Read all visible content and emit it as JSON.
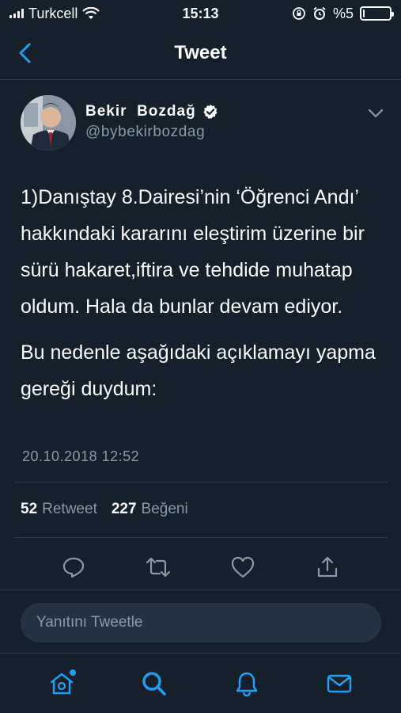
{
  "status_bar": {
    "carrier": "Turkcell",
    "time": "15:13",
    "battery": "%5",
    "battery_level": 0.05
  },
  "nav": {
    "title": "Tweet"
  },
  "tweet": {
    "author_name": "Bekir  Bozdağ",
    "author_handle": "@bybekirbozdag",
    "paragraphs": [
      "1)Danıştay 8.Dairesi’nin ‘Öğrenci Andı’ hakkındaki kararını eleştirim üzerine bir sürü hakaret,iftira ve tehdide muhatap oldum. Hala da bunlar devam ediyor.",
      "Bu nedenle aşağıdaki açıklamayı yapma gereği duydum:"
    ],
    "timestamp": "20.10.2018 12:52",
    "retweet_count": "52",
    "retweet_label": "Retweet",
    "like_count": "227",
    "like_label": "Beğeni"
  },
  "reply": {
    "placeholder": "Yanıtını Tweetle"
  },
  "icons": {
    "back": "chevron-left-icon",
    "verified": "verified-badge-icon",
    "more": "chevron-down-icon",
    "reply": "reply-icon",
    "retweet": "retweet-icon",
    "like": "heart-icon",
    "share": "share-icon",
    "home": "home-icon",
    "search": "search-icon",
    "notifications": "bell-icon",
    "messages": "mail-icon"
  },
  "colors": {
    "background": "#15202b",
    "accent": "#1da1f2",
    "secondary_text": "#8899a6"
  }
}
